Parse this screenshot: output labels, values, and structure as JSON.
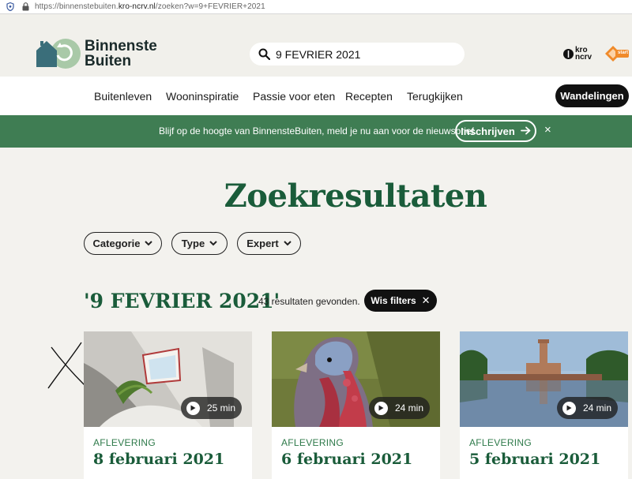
{
  "browser": {
    "url_prefix": "https://binnenstebuiten.",
    "url_domain": "kro-ncrv.nl",
    "url_suffix": "/zoeken?w=9+FEVRIER+2021"
  },
  "header": {
    "logo_line1": "Binnenste",
    "logo_line2": "Buiten",
    "search_value": "9 FEVRIER 2021",
    "kro_text1": "kro",
    "kro_text2": "ncrv",
    "npo_text": "start"
  },
  "nav": {
    "items": [
      "Buitenleven",
      "Wooninspiratie",
      "Passie voor eten",
      "Recepten",
      "Terugkijken"
    ],
    "cta": "Wandelingen"
  },
  "banner": {
    "message": "Blijf op de hoogte van BinnensteBuiten, meld je nu aan voor de nieuwsbrief.",
    "button": "Inschrijven",
    "close": "×"
  },
  "page": {
    "title": "Zoekresultaten",
    "filters": [
      "Categorie",
      "Type",
      "Expert"
    ],
    "query": "'9 FEVRIER 2021'",
    "result_count": "43 resultaten gevonden.",
    "clear_filters": "Wis filters"
  },
  "cards": [
    {
      "type": "AFLEVERING",
      "title": "8 februari 2021",
      "duration": "25 min"
    },
    {
      "type": "AFLEVERING",
      "title": "6 februari 2021",
      "duration": "24 min"
    },
    {
      "type": "AFLEVERING",
      "title": "5 februari 2021",
      "duration": "24 min"
    }
  ],
  "colors": {
    "brand_green": "#1a5c3a",
    "banner_green": "#3f7d53",
    "header_bg": "#f1f0eb"
  }
}
